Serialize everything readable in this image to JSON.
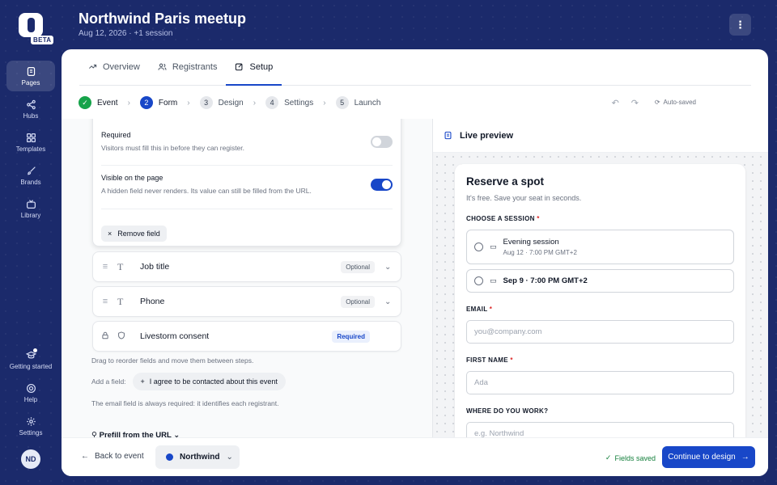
{
  "brand": {
    "badge": "BETA",
    "accent": "#1847c8",
    "sidebar_bg": "#1b2a6b"
  },
  "sidebar": {
    "items": [
      {
        "label": "Pages",
        "icon": "pages-icon",
        "active": true
      },
      {
        "label": "Hubs",
        "icon": "share-icon"
      },
      {
        "label": "Templates",
        "icon": "grid-icon"
      },
      {
        "label": "Brands",
        "icon": "brush-icon"
      },
      {
        "label": "Library",
        "icon": "tv-icon"
      }
    ],
    "bottom": [
      {
        "label": "Getting started",
        "icon": "graduation-cap-icon"
      },
      {
        "label": "Help",
        "icon": "lifebuoy-icon"
      },
      {
        "label": "Settings",
        "icon": "gear-icon"
      }
    ],
    "avatar": "ND"
  },
  "header": {
    "title": "Northwind Paris meetup",
    "subtitle": "Aug 12, 2026 · +1 session",
    "more": "⋮"
  },
  "tabs": [
    {
      "label": "Overview",
      "icon": "trend-icon"
    },
    {
      "label": "Registrants",
      "icon": "users-icon"
    },
    {
      "label": "Setup",
      "icon": "edit-icon",
      "active": true
    }
  ],
  "steps": [
    {
      "num": "✓",
      "label": "Event",
      "state": "done"
    },
    {
      "num": "2",
      "label": "Form",
      "state": "current"
    },
    {
      "num": "3",
      "label": "Design"
    },
    {
      "num": "4",
      "label": "Settings"
    },
    {
      "num": "5",
      "label": "Launch"
    }
  ],
  "autosaved": "Auto-saved",
  "field_editor": {
    "required_title": "Required",
    "required_desc": "Visitors must fill this in before they can register.",
    "required_on": false,
    "visible_title": "Visible on the page",
    "visible_desc": "A hidden field never renders. Its value can still be filled from the URL.",
    "visible_on": true,
    "remove_label": "Remove field"
  },
  "fields": [
    {
      "name": "Job title",
      "badge": "Optional"
    },
    {
      "name": "Phone",
      "badge": "Optional"
    },
    {
      "name": "Livestorm consent",
      "badge": "Required"
    }
  ],
  "help": {
    "reorder": "Drag to reorder fields and move them between steps.",
    "add_label": "Add a field:",
    "add_chip": "I agree to be contacted about this event",
    "email_note": "The email field is always required: it identifies each registrant.",
    "prefill": "Prefill from the URL"
  },
  "preview": {
    "heading": "Live preview",
    "title": "Reserve a spot",
    "subtitle": "It's free. Save your seat in seconds.",
    "session_label": "CHOOSE A SESSION",
    "sessions": [
      {
        "title": "Evening session",
        "sub": "Aug 12 · 7:00 PM GMT+2"
      },
      {
        "title": "Sep 9 · 7:00 PM GMT+2"
      }
    ],
    "email_label": "EMAIL",
    "email_placeholder": "you@company.com",
    "first_label": "FIRST NAME",
    "first_placeholder": "Ada",
    "work_label": "WHERE DO YOU WORK?",
    "work_placeholder": "e.g. Northwind"
  },
  "footer": {
    "back": "Back to event",
    "brand": "Northwind",
    "saved": "Fields saved",
    "continue": "Continue to design"
  }
}
